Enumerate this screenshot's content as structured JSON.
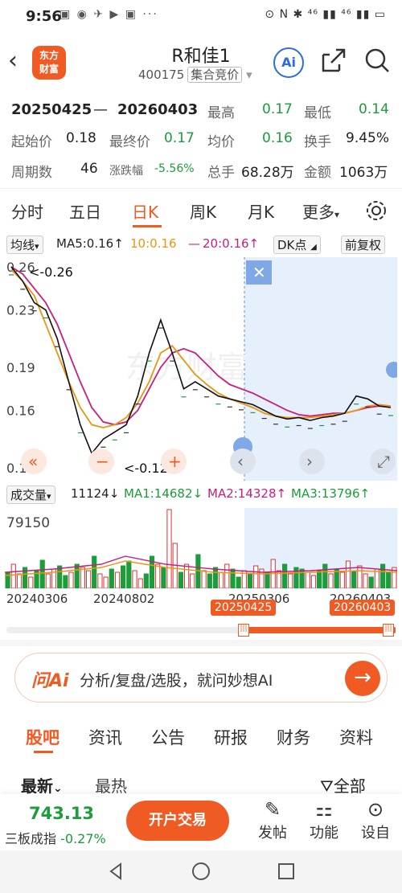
{
  "status": {
    "time": "9:56",
    "right": "⊙ N ✱ ⁴⁶ ▮▮ ⁴⁶ ▮▮ ▭"
  },
  "header": {
    "logo_line1": "东方",
    "logo_line2": "财富",
    "name": "R和佳1",
    "code": "400175",
    "mode": "集合竞价",
    "ai": "Ai"
  },
  "stats": {
    "range_start": "20250425",
    "range_sep": "—",
    "range_end": "20260403",
    "high_label": "最高",
    "high": "0.17",
    "low_label": "最低",
    "low": "0.14",
    "open_label": "起始价",
    "open": "0.18",
    "close_label": "最终价",
    "close": "0.17",
    "avg_label": "均价",
    "avg": "0.16",
    "turn_label": "换手",
    "turn": "9.45%",
    "days_label": "周期数",
    "days": "46",
    "chg_label": "涨跌幅",
    "chg": "-5.56%",
    "vol_label": "总手",
    "vol": "68.28万",
    "amt_label": "金额",
    "amt": "1063万"
  },
  "tabs": [
    "分时",
    "五日",
    "日K",
    "周K",
    "月K",
    "更多"
  ],
  "active_tab": "日K",
  "ma_bar": {
    "selector": "均线",
    "ma5": "MA5:0.16↑",
    "ma10": "10:0.16",
    "ma20": "20:0.16↑",
    "dk": "DK点",
    "adjust": "前复权"
  },
  "chart_data": {
    "type": "line",
    "y_ticks": [
      "0.26",
      "0.23",
      "0.19",
      "0.16",
      "0.12"
    ],
    "ylim": [
      0.12,
      0.26
    ],
    "high_label": "<-0.26",
    "low_label": "<-0.12",
    "series": [
      {
        "name": "MA5",
        "color": "#c81e7c",
        "values": [
          0.26,
          0.255,
          0.245,
          0.235,
          0.22,
          0.2,
          0.18,
          0.162,
          0.152,
          0.15,
          0.152,
          0.16,
          0.175,
          0.19,
          0.2,
          0.203,
          0.2,
          0.192,
          0.184,
          0.178,
          0.175,
          0.172,
          0.168,
          0.164,
          0.16,
          0.157,
          0.156,
          0.157,
          0.158,
          0.158,
          0.16,
          0.162,
          0.163,
          0.163
        ]
      },
      {
        "name": "MA10",
        "color": "#e8970f",
        "values": [
          0.258,
          0.25,
          0.24,
          0.22,
          0.2,
          0.18,
          0.162,
          0.15,
          0.148,
          0.15,
          0.155,
          0.165,
          0.18,
          0.2,
          0.205,
          0.195,
          0.185,
          0.178,
          0.172,
          0.168,
          0.165,
          0.162,
          0.158,
          0.156,
          0.155,
          0.155,
          0.155,
          0.156,
          0.157,
          0.158,
          0.16,
          0.163,
          0.164,
          0.163
        ]
      },
      {
        "name": "Close",
        "color": "#111111",
        "values": [
          0.26,
          0.25,
          0.235,
          0.23,
          0.21,
          0.18,
          0.15,
          0.13,
          0.14,
          0.145,
          0.15,
          0.17,
          0.2,
          0.223,
          0.2,
          0.175,
          0.18,
          0.175,
          0.17,
          0.168,
          0.166,
          0.164,
          0.16,
          0.156,
          0.154,
          0.155,
          0.153,
          0.155,
          0.156,
          0.158,
          0.17,
          0.168,
          0.163,
          0.162
        ]
      }
    ],
    "vol_ticks": [
      "79150"
    ],
    "x_labels": [
      "20240306",
      "20240802",
      "20250306",
      "20260403"
    ]
  },
  "vol_legend": {
    "name": "成交量",
    "val": "11124↓",
    "ma1": "MA1:14682↓",
    "ma2": "MA2:14328↑",
    "ma3": "MA3:13796↑"
  },
  "range_bar": {
    "start": "20250425",
    "end": "20260403"
  },
  "ai_bar": {
    "logo": "问Ai",
    "text": "分析/复盘/选股，就问妙想AI"
  },
  "news_tabs": [
    "股吧",
    "资讯",
    "公告",
    "研报",
    "财务",
    "资料"
  ],
  "sort": {
    "latest": "最新",
    "hot": "最热",
    "filter": "全部"
  },
  "bottom": {
    "index_value": "743.13",
    "index_name": "三板成指",
    "index_chg": "-0.27%",
    "trade": "开户交易",
    "post": "发帖",
    "func": "功能",
    "settings": "设自"
  }
}
